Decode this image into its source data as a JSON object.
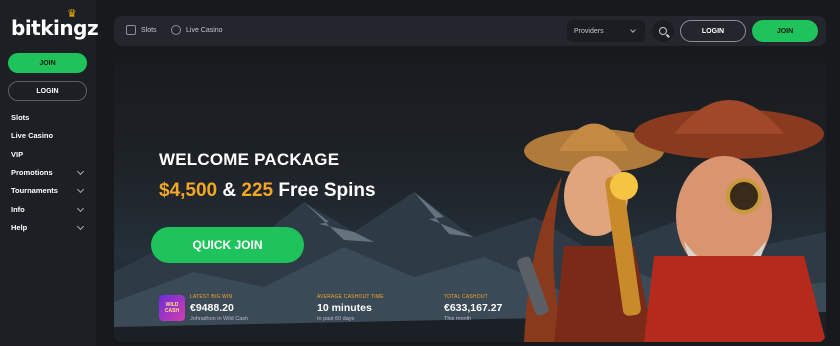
{
  "logo": {
    "text": "bitkingz"
  },
  "sidebar": {
    "join_label": "JOIN",
    "login_label": "LOGIN",
    "items": [
      {
        "label": "Slots",
        "has_chevron": false
      },
      {
        "label": "Live Casino",
        "has_chevron": false
      },
      {
        "label": "VIP",
        "has_chevron": false
      },
      {
        "label": "Promotions",
        "has_chevron": true
      },
      {
        "label": "Tournaments",
        "has_chevron": true
      },
      {
        "label": "Info",
        "has_chevron": true
      },
      {
        "label": "Help",
        "has_chevron": true
      }
    ]
  },
  "topbar": {
    "slots_label": "Slots",
    "live_casino_label": "Live Casino",
    "providers_label": "Providers",
    "login_label": "LOGIN",
    "join_label": "JOIN"
  },
  "hero": {
    "welcome": "WELCOME PACKAGE",
    "amount": "$4,500",
    "and": "&",
    "spins_count": "225",
    "spins_label": "Free Spins",
    "cta": "QUICK JOIN",
    "game_thumb_text": "WILD CASH"
  },
  "stats": [
    {
      "label": "LATEST BIG WIN",
      "value": "€9488.20",
      "sub": "Johnathon in Wild Cash"
    },
    {
      "label": "AVERAGE CASHOUT TIME",
      "value": "10 minutes",
      "sub": "In past 60 days"
    },
    {
      "label": "TOTAL CASHOUT",
      "value": "€633,167.27",
      "sub": "This month"
    }
  ],
  "colors": {
    "accent_green": "#1fc35c",
    "accent_gold": "#f6a623",
    "bg": "#17191d"
  }
}
